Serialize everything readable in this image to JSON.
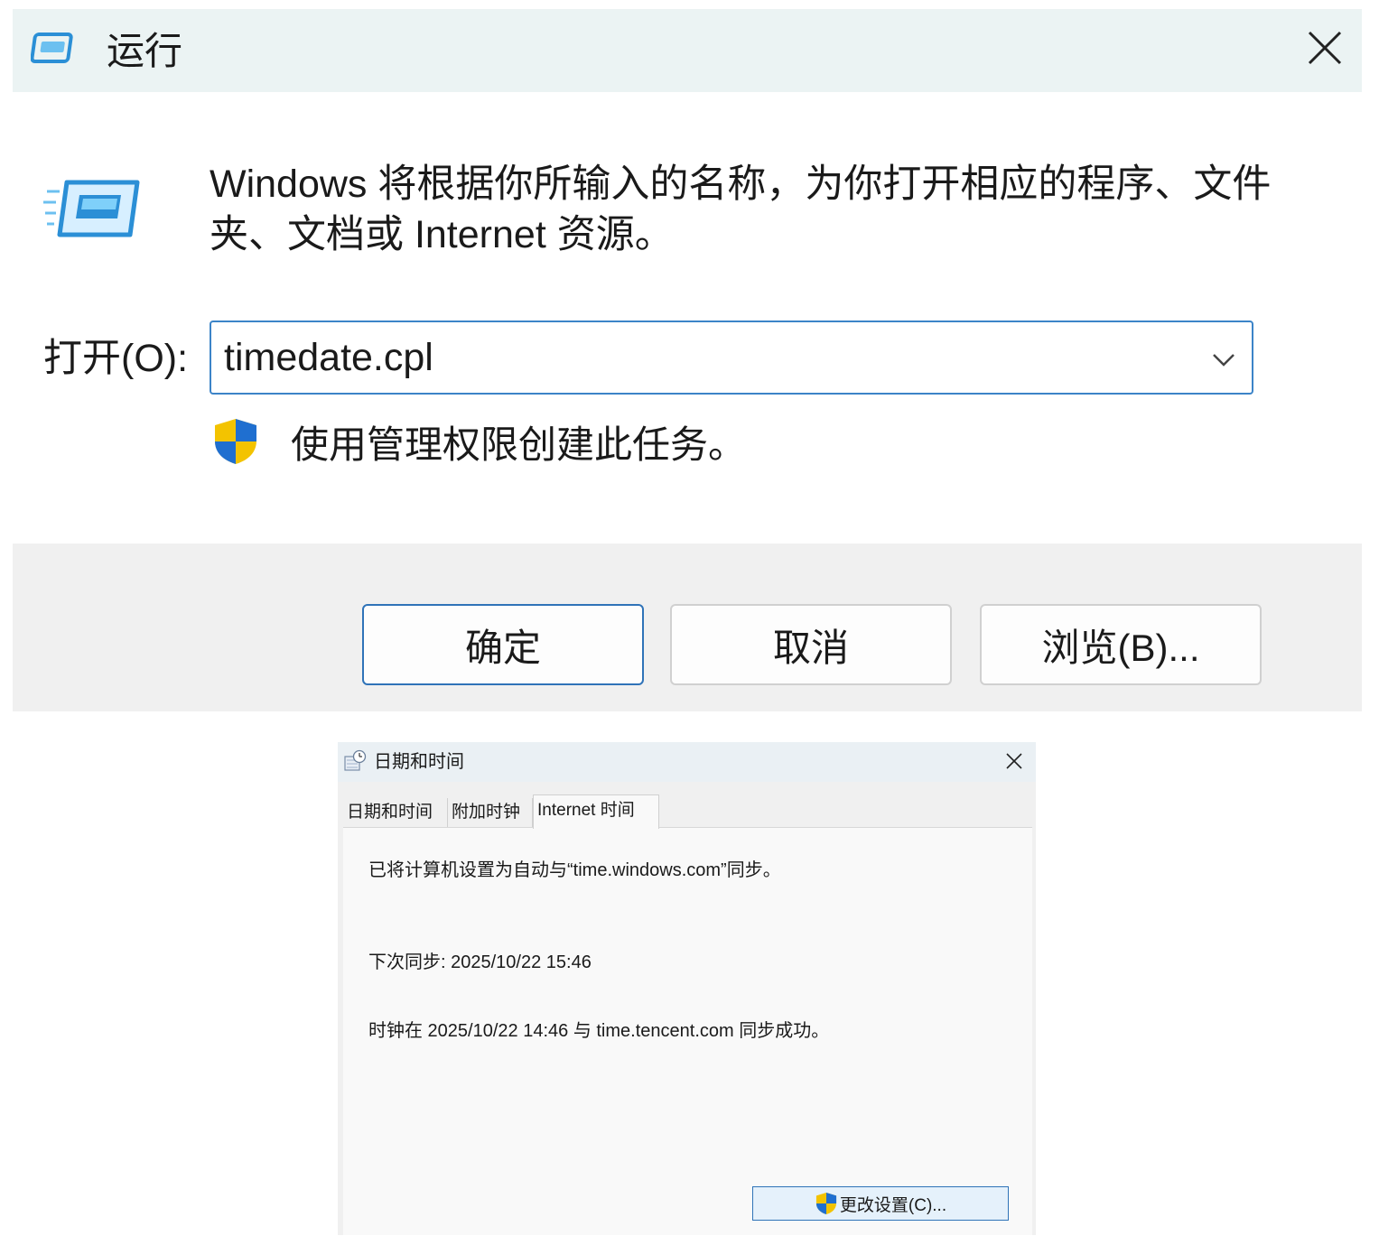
{
  "run_dialog": {
    "title": "运行",
    "description": "Windows 将根据你所输入的名称，为你打开相应的程序、文件夹、文档或 Internet 资源。",
    "open_label": "打开(O):",
    "open_value": "timedate.cpl",
    "admin_note": "使用管理权限创建此任务。",
    "buttons": {
      "ok": "确定",
      "cancel": "取消",
      "browse": "浏览(B)..."
    },
    "icons": [
      "run-app-icon",
      "close-icon",
      "chevron-down-icon",
      "uac-shield-icon"
    ],
    "colors": {
      "title_bar": "#ebf3f3",
      "footer": "#f0f0f0",
      "accent": "#2f73b8"
    }
  },
  "datetime_dialog": {
    "title": "日期和时间",
    "tabs": [
      "日期和时间",
      "附加时钟",
      "Internet 时间"
    ],
    "active_tab": "Internet 时间",
    "sync_info": "已将计算机设置为自动与“time.windows.com”同步。",
    "next_sync": "下次同步: 2025/10/22 15:46",
    "last_sync": "时钟在 2025/10/22 14:46 与 time.tencent.com 同步成功。",
    "change_settings_button": "更改设置(C)...",
    "icons": [
      "datetime-control-icon",
      "close-icon",
      "uac-shield-icon"
    ]
  }
}
